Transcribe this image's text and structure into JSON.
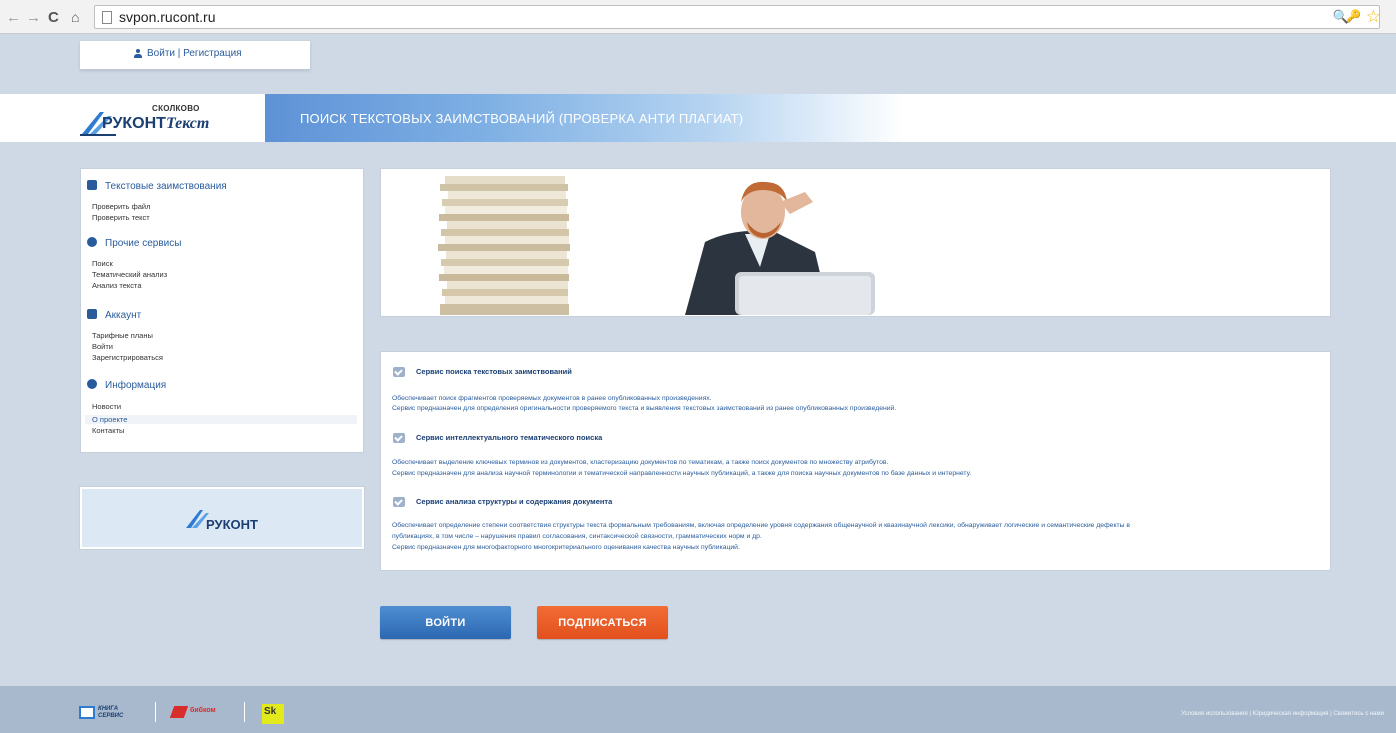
{
  "browser": {
    "back_icon": "←",
    "forward_icon": "→",
    "reload_icon": "C",
    "home_icon": "⌂",
    "url": "svpon.rucont.ru",
    "zoom_icon": "🔍",
    "key_icon": "🔑",
    "star_icon": "☆"
  },
  "topbar": {
    "login_text": "Войти | Регистрация"
  },
  "header": {
    "logo_sk": "СКОЛКОВО",
    "logo_brand_a": "РУКОНТ",
    "logo_brand_b": "екст",
    "logo_brand_t": "Т",
    "banner_title": "ПОИСК ТЕКСТОВЫХ ЗАИМСТВОВАНИЙ (ПРОВЕРКА АНТИ ПЛАГИАТ)"
  },
  "sidebar": {
    "sections": [
      {
        "label": "Текстовые заимствования",
        "icon": "document-icon",
        "items": [
          "Проверить файл",
          "Проверить текст"
        ]
      },
      {
        "label": "Прочие сервисы",
        "icon": "gear-icon",
        "items": [
          "Поиск",
          "Тематический анализ",
          "Анализ текста"
        ]
      },
      {
        "label": "Аккаунт",
        "icon": "lock-icon",
        "items": [
          "Тарифные планы",
          "Войти",
          "Зарегистрироваться"
        ]
      },
      {
        "label": "Информация",
        "icon": "info-icon",
        "items": [
          "Новости",
          "О проекте",
          "Контакты"
        ]
      }
    ],
    "active_item": "О проекте",
    "partner_logo": "РУКОНТ"
  },
  "services": [
    {
      "title": "Сервис поиска текстовых заимствований",
      "lines": [
        "Обеспечивает поиск фрагментов проверяемых документов в ранее опубликованных произведениях.",
        "Сервис предназначен для определения оригинальности проверяемого текста и выявления текстовых заимствований из ранее опубликованных произведений."
      ]
    },
    {
      "title": "Сервис интеллектуального тематического поиска",
      "lines": [
        "Обеспечивает выделение ключевых терминов из документов, кластеризацию документов по тематикам, а также поиск документов по множеству атрибутов.",
        "Сервис предназначен для анализа научной терминологии и тематической направленности научных публикаций, а также для поиска научных документов по базе данных и интернету."
      ]
    },
    {
      "title": "Сервис анализа структуры и содержания документа",
      "lines": [
        "Обеспечивает определение степени соответствия структуры текста формальным требованиям, включая определение уровня содержания общенаучной и квазинаучной лексики, обнаруживает логические и семантические дефекты в",
        "публикациях, в том числе – нарушения правил согласования, синтаксической связности, грамматических норм и др.",
        "Сервис предназначен для многофакторного многокритериального оценивания качества научных публикаций."
      ]
    }
  ],
  "buttons": {
    "login": "ВОЙТИ",
    "subscribe": "ПОДПИСАТЬСЯ"
  },
  "footer": {
    "logo1_line1": "КНИГА",
    "logo1_line2": "СЕРВИС",
    "logo2": "бибком",
    "logo3": "Sk",
    "links": "Условия использования | Юридическая информация | Свяжитесь с нами"
  },
  "colors": {
    "page_bg": "#cfd9e6",
    "brand_blue": "#2a5c9c",
    "login_button": "#2c68b3",
    "subscribe_button": "#e2501d"
  }
}
